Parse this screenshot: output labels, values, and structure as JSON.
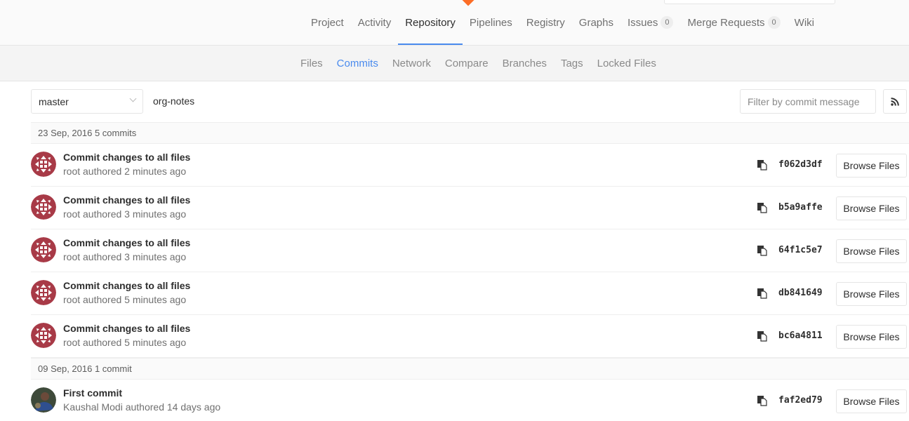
{
  "colors": {
    "accent": "#4a8bee",
    "logo": "#fc6d26",
    "avatar_identicon": "#a83a47"
  },
  "top_nav": {
    "tabs": [
      {
        "label": "Project"
      },
      {
        "label": "Activity"
      },
      {
        "label": "Repository",
        "active": true
      },
      {
        "label": "Pipelines"
      },
      {
        "label": "Registry"
      },
      {
        "label": "Graphs"
      },
      {
        "label": "Issues",
        "count": "0"
      },
      {
        "label": "Merge Requests",
        "count": "0"
      },
      {
        "label": "Wiki"
      }
    ]
  },
  "sub_nav": {
    "tabs": [
      {
        "label": "Files"
      },
      {
        "label": "Commits",
        "active": true
      },
      {
        "label": "Network"
      },
      {
        "label": "Compare"
      },
      {
        "label": "Branches"
      },
      {
        "label": "Tags"
      },
      {
        "label": "Locked Files"
      }
    ]
  },
  "toolbar": {
    "branch": "master",
    "path": "org-notes",
    "filter_placeholder": "Filter by commit message",
    "rss_icon": "rss-icon"
  },
  "commit_groups": [
    {
      "header": "23 Sep, 2016 5 commits",
      "commits": [
        {
          "title": "Commit changes to all files",
          "meta": "root authored 2 minutes ago",
          "sha": "f062d3df",
          "browse": "Browse Files",
          "avatar": "identicon"
        },
        {
          "title": "Commit changes to all files",
          "meta": "root authored 3 minutes ago",
          "sha": "b5a9affe",
          "browse": "Browse Files",
          "avatar": "identicon"
        },
        {
          "title": "Commit changes to all files",
          "meta": "root authored 3 minutes ago",
          "sha": "64f1c5e7",
          "browse": "Browse Files",
          "avatar": "identicon"
        },
        {
          "title": "Commit changes to all files",
          "meta": "root authored 5 minutes ago",
          "sha": "db841649",
          "browse": "Browse Files",
          "avatar": "identicon"
        },
        {
          "title": "Commit changes to all files",
          "meta": "root authored 5 minutes ago",
          "sha": "bc6a4811",
          "browse": "Browse Files",
          "avatar": "identicon"
        }
      ]
    },
    {
      "header": "09 Sep, 2016 1 commit",
      "commits": [
        {
          "title": "First commit",
          "meta": "Kaushal Modi authored 14 days ago",
          "sha": "faf2ed79",
          "browse": "Browse Files",
          "avatar": "photo"
        }
      ]
    }
  ]
}
